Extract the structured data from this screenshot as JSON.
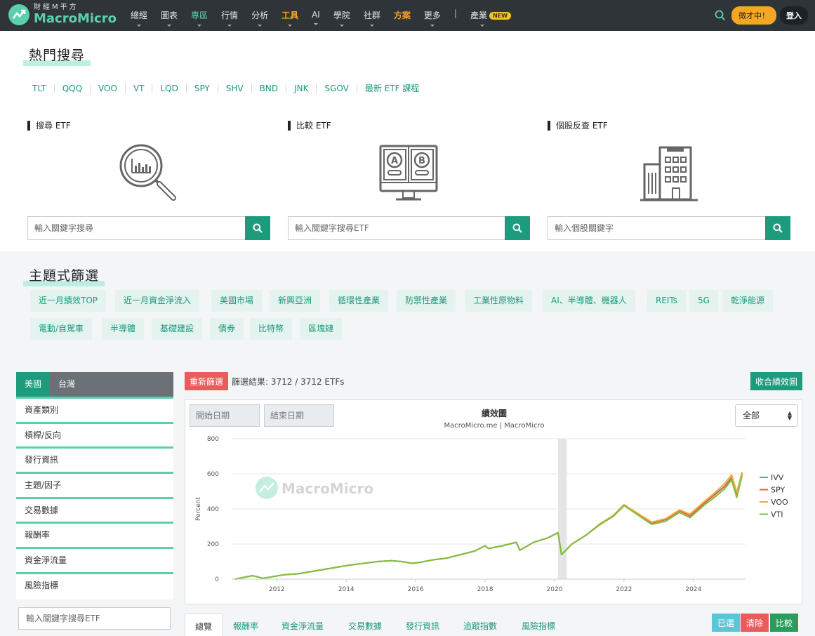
{
  "nav": {
    "logo_sub": "財經M平方",
    "logo_main": "MacroMicro",
    "items": [
      "總經",
      "圖表",
      "專區",
      "行情",
      "分析",
      "工具",
      "AI",
      "學院",
      "社群",
      "方案",
      "更多"
    ],
    "separator": "|",
    "industry": "產業",
    "new_badge": "NEW",
    "recruit": "徵才中！",
    "login": "登入"
  },
  "hot_search": {
    "title": "熱門搜尋",
    "links": [
      "TLT",
      "QQQ",
      "VOO",
      "VT",
      "LQD",
      "SPY",
      "SHV",
      "BND",
      "JNK",
      "SGOV",
      "最新 ETF 課程"
    ]
  },
  "tools": [
    {
      "label": "搜尋 ETF",
      "placeholder": "輸入關鍵字搜尋",
      "icon": "magnifier-chart-icon"
    },
    {
      "label": "比較 ETF",
      "placeholder": "輸入關鍵字搜尋ETF",
      "icon": "compare-monitor-icon"
    },
    {
      "label": "個股反查 ETF",
      "placeholder": "輸入個股關鍵字",
      "icon": "building-icon"
    }
  ],
  "theme": {
    "title": "主題式篩選",
    "tags": [
      "近一月績效TOP",
      "近一月資金淨流入",
      "美國市場",
      "新興亞洲",
      "循環性產業",
      "防禦性產業",
      "工業性原物料",
      "AI、半導體、機器人",
      "REITs",
      "5G",
      "乾淨能源",
      "電動/自駕車",
      "半導體",
      "基礎建設",
      "債券",
      "比特幣",
      "區塊鏈"
    ]
  },
  "filter": {
    "tabs": [
      "美國",
      "台灣"
    ],
    "items": [
      "資產類別",
      "槓桿/反向",
      "發行資訊",
      "主題/因子",
      "交易數據",
      "報酬率",
      "資金淨流量",
      "風險指標"
    ],
    "search_placeholder": "輸入關鍵字搜尋ETF"
  },
  "results": {
    "reset": "重新篩選",
    "text": "篩選結果: 3712 / 3712 ETFs",
    "collapse": "收合績效圖"
  },
  "chart_panel": {
    "start_placeholder": "開始日期",
    "end_placeholder": "結束日期",
    "range_selected": "全部",
    "watermark": "MacroMicro"
  },
  "chart_data": {
    "type": "line",
    "title": "績效圖",
    "subtitle": "MacroMicro.me | MacroMicro",
    "ylabel": "Percent",
    "xlabel": "",
    "ylim": [
      0,
      800
    ],
    "yticks": [
      0,
      200,
      400,
      600,
      800
    ],
    "xlim": [
      2010.7,
      2025.5
    ],
    "xticks": [
      2012,
      2014,
      2016,
      2018,
      2020,
      2022,
      2024
    ],
    "shaded_period": [
      2020.1,
      2020.35
    ],
    "legend_position": "right",
    "x": [
      2010.8,
      2011.0,
      2011.3,
      2011.6,
      2011.9,
      2012.2,
      2012.6,
      2012.9,
      2013.2,
      2013.5,
      2013.8,
      2014.1,
      2014.5,
      2014.9,
      2015.3,
      2015.6,
      2015.9,
      2016.1,
      2016.5,
      2016.9,
      2017.3,
      2017.7,
      2018.0,
      2018.1,
      2018.5,
      2018.9,
      2019.0,
      2019.4,
      2019.8,
      2020.1,
      2020.2,
      2020.5,
      2020.9,
      2021.3,
      2021.7,
      2022.0,
      2022.4,
      2022.8,
      2023.2,
      2023.6,
      2023.9,
      2024.3,
      2024.6,
      2024.9,
      2025.1,
      2025.25,
      2025.4
    ],
    "series": [
      {
        "name": "IVV",
        "color": "#4aa7d8",
        "values": [
          0,
          8,
          20,
          5,
          15,
          25,
          30,
          40,
          50,
          60,
          70,
          80,
          90,
          100,
          105,
          100,
          90,
          95,
          110,
          120,
          140,
          160,
          190,
          175,
          190,
          210,
          165,
          210,
          235,
          265,
          140,
          200,
          250,
          310,
          360,
          420,
          370,
          320,
          340,
          390,
          360,
          430,
          480,
          530,
          580,
          480,
          600
        ]
      },
      {
        "name": "SPY",
        "color": "#e8603c",
        "values": [
          0,
          8,
          20,
          5,
          15,
          25,
          30,
          40,
          50,
          60,
          70,
          80,
          90,
          100,
          105,
          100,
          90,
          95,
          110,
          120,
          140,
          160,
          190,
          175,
          190,
          210,
          165,
          210,
          235,
          265,
          140,
          200,
          250,
          310,
          360,
          420,
          370,
          320,
          340,
          390,
          360,
          430,
          478,
          528,
          578,
          478,
          598
        ]
      },
      {
        "name": "VOO",
        "color": "#f3a93c",
        "values": [
          0,
          8,
          20,
          5,
          15,
          25,
          30,
          40,
          50,
          60,
          70,
          80,
          90,
          100,
          105,
          100,
          90,
          95,
          110,
          120,
          140,
          160,
          190,
          175,
          190,
          210,
          165,
          210,
          235,
          265,
          140,
          200,
          250,
          315,
          365,
          425,
          375,
          325,
          345,
          395,
          370,
          440,
          490,
          545,
          595,
          495,
          610
        ]
      },
      {
        "name": "VTI",
        "color": "#7cc142",
        "values": [
          0,
          8,
          20,
          5,
          15,
          25,
          30,
          40,
          50,
          60,
          70,
          80,
          90,
          100,
          105,
          100,
          90,
          95,
          110,
          120,
          140,
          160,
          190,
          175,
          190,
          210,
          165,
          210,
          235,
          265,
          140,
          200,
          250,
          310,
          360,
          420,
          365,
          312,
          330,
          380,
          350,
          420,
          465,
          515,
          565,
          465,
          590
        ]
      }
    ]
  },
  "bottom_tabs": [
    "總覽",
    "報酬率",
    "資金淨流量",
    "交易數據",
    "發行資訊",
    "追蹤指數",
    "風險指標"
  ],
  "actions": {
    "selected": "已選",
    "clear": "清除",
    "compare": "比較"
  }
}
